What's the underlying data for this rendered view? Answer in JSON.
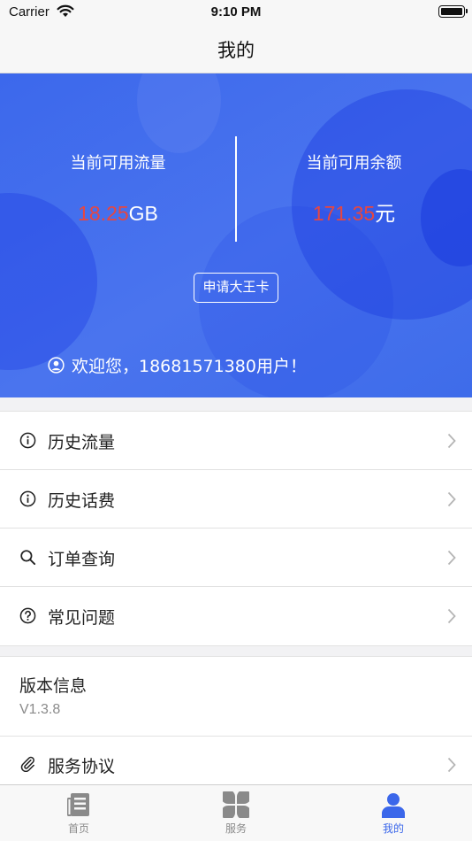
{
  "status_bar": {
    "carrier": "Carrier",
    "time": "9:10 PM"
  },
  "nav": {
    "title": "我的"
  },
  "summary": {
    "traffic_label": "当前可用流量",
    "traffic_value": "18.25",
    "traffic_unit": "GB",
    "balance_label": "当前可用余额",
    "balance_value": "171.35",
    "balance_unit": "元",
    "apply_button": "申请大王卡",
    "welcome": "欢迎您，18681571380用户！"
  },
  "menu": [
    {
      "label": "历史流量",
      "icon": "info-icon"
    },
    {
      "label": "历史话费",
      "icon": "info-icon"
    },
    {
      "label": "订单查询",
      "icon": "search-icon"
    },
    {
      "label": "常见问题",
      "icon": "question-icon"
    }
  ],
  "version": {
    "title": "版本信息",
    "value": "V1.3.8"
  },
  "agreement": {
    "label": "服务协议",
    "icon": "paperclip-icon"
  },
  "tabs": [
    {
      "label": "首页",
      "icon": "news-icon"
    },
    {
      "label": "服务",
      "icon": "grid-petals-icon"
    },
    {
      "label": "我的",
      "icon": "person-icon",
      "active": true
    }
  ],
  "colors": {
    "accent": "#3b67ea",
    "value_red": "#e8463f",
    "hero_blue": "#4470ec"
  }
}
